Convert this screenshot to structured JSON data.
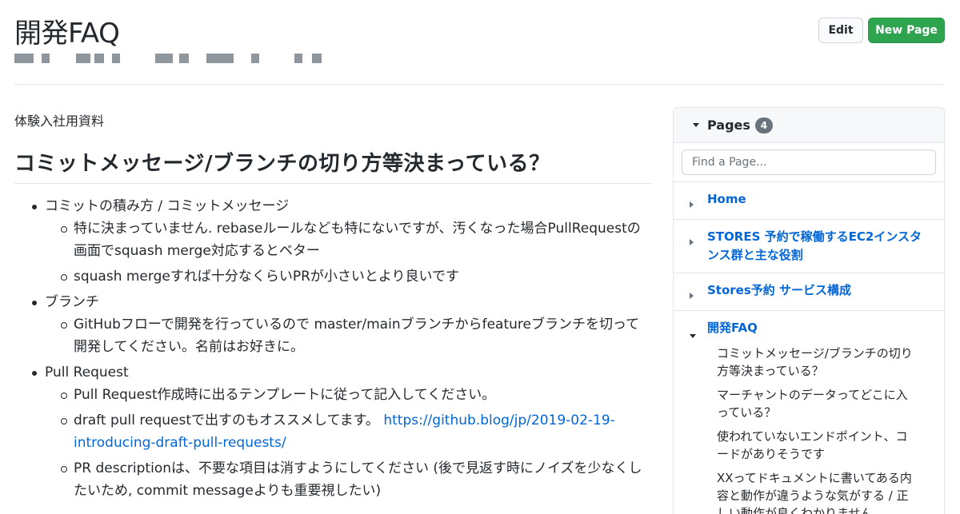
{
  "header": {
    "title": "開発FAQ",
    "edit_label": "Edit",
    "new_page_label": "New Page"
  },
  "content": {
    "subtitle": "体験入社用資料",
    "heading": "コミットメッセージ/ブランチの切り方等決まっている？",
    "items": [
      {
        "label": "コミットの積み方 / コミットメッセージ",
        "sub": [
          "特に決まっていません. rebaseルールなども特にないですが、汚くなった場合PullRequestの画面でsquash merge対応するとベター",
          "squash mergeすれば十分なくらいPRが小さいとより良いです"
        ]
      },
      {
        "label": "ブランチ",
        "sub": [
          "GitHubフローで開発を行っているので master/mainブランチからfeatureブランチを切って開発してください。名前はお好きに。"
        ]
      },
      {
        "label": "Pull Request",
        "sub": [
          "Pull Request作成時に出るテンプレートに従って記入してください。",
          "draft pull requestで出すのもオススメしてます。",
          "PR descriptionは、不要な項目は消すようにしてください (後で見返す時にノイズを少なくしたいため, commit messageよりも重要視したい)"
        ],
        "link": "https://github.blog/jp/2019-02-19-introducing-draft-pull-requests/"
      }
    ]
  },
  "sidebar": {
    "title": "Pages",
    "count": "4",
    "search_placeholder": "Find a Page...",
    "pages": [
      {
        "label": "Home"
      },
      {
        "label": "STORES 予約で稼働するEC2インスタンス群と主な役割"
      },
      {
        "label": "Stores予約 サービス構成"
      },
      {
        "label": "開発FAQ"
      }
    ],
    "subpages": [
      "コミットメッセージ/ブランチの切り方等決まっている？",
      "マーチャントのデータってどこに入っている？",
      "使われていないエンドポイント、コードがありそうです",
      "XXってドキュメントに書いてある内容と動作が違うような気がする / 正しい動作が良くわかりません"
    ]
  },
  "colors": {
    "link": "#0366d6",
    "primary_button": "#2ea44f",
    "counter_badge": "#6a737d"
  }
}
